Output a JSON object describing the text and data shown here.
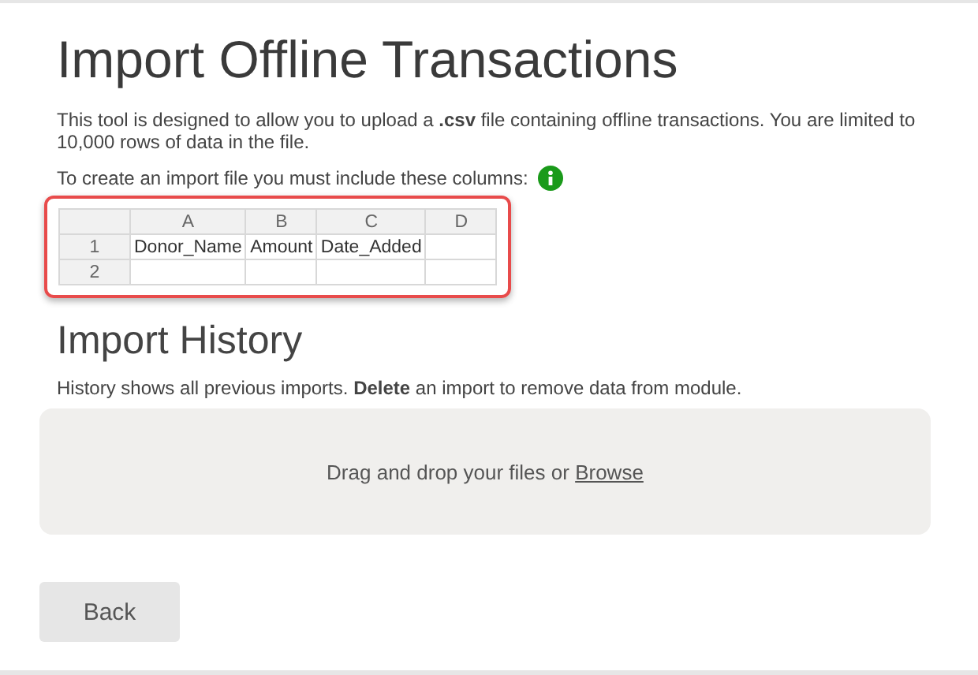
{
  "title": "Import Offline Transactions",
  "intro": "This tool is designed to allow you to upload a **.csv** file containing offline transactions. You are limited to 10,000 rows of data in the file.",
  "columns_note": "To create an import file you must include these columns:",
  "sheet": {
    "column_headers": [
      "A",
      "B",
      "C",
      "D"
    ],
    "rows": [
      {
        "header": "1",
        "cells": [
          "Donor_Name",
          "Amount",
          "Date_Added",
          ""
        ]
      },
      {
        "header": "2",
        "cells": [
          "",
          "",
          "",
          ""
        ]
      }
    ]
  },
  "history": {
    "title": "Import History",
    "description": "History shows all previous imports. **Delete** an import to remove data from module."
  },
  "dropzone": {
    "text": "Drag and drop your files or",
    "link": "Browse"
  },
  "back_button": "Back"
}
